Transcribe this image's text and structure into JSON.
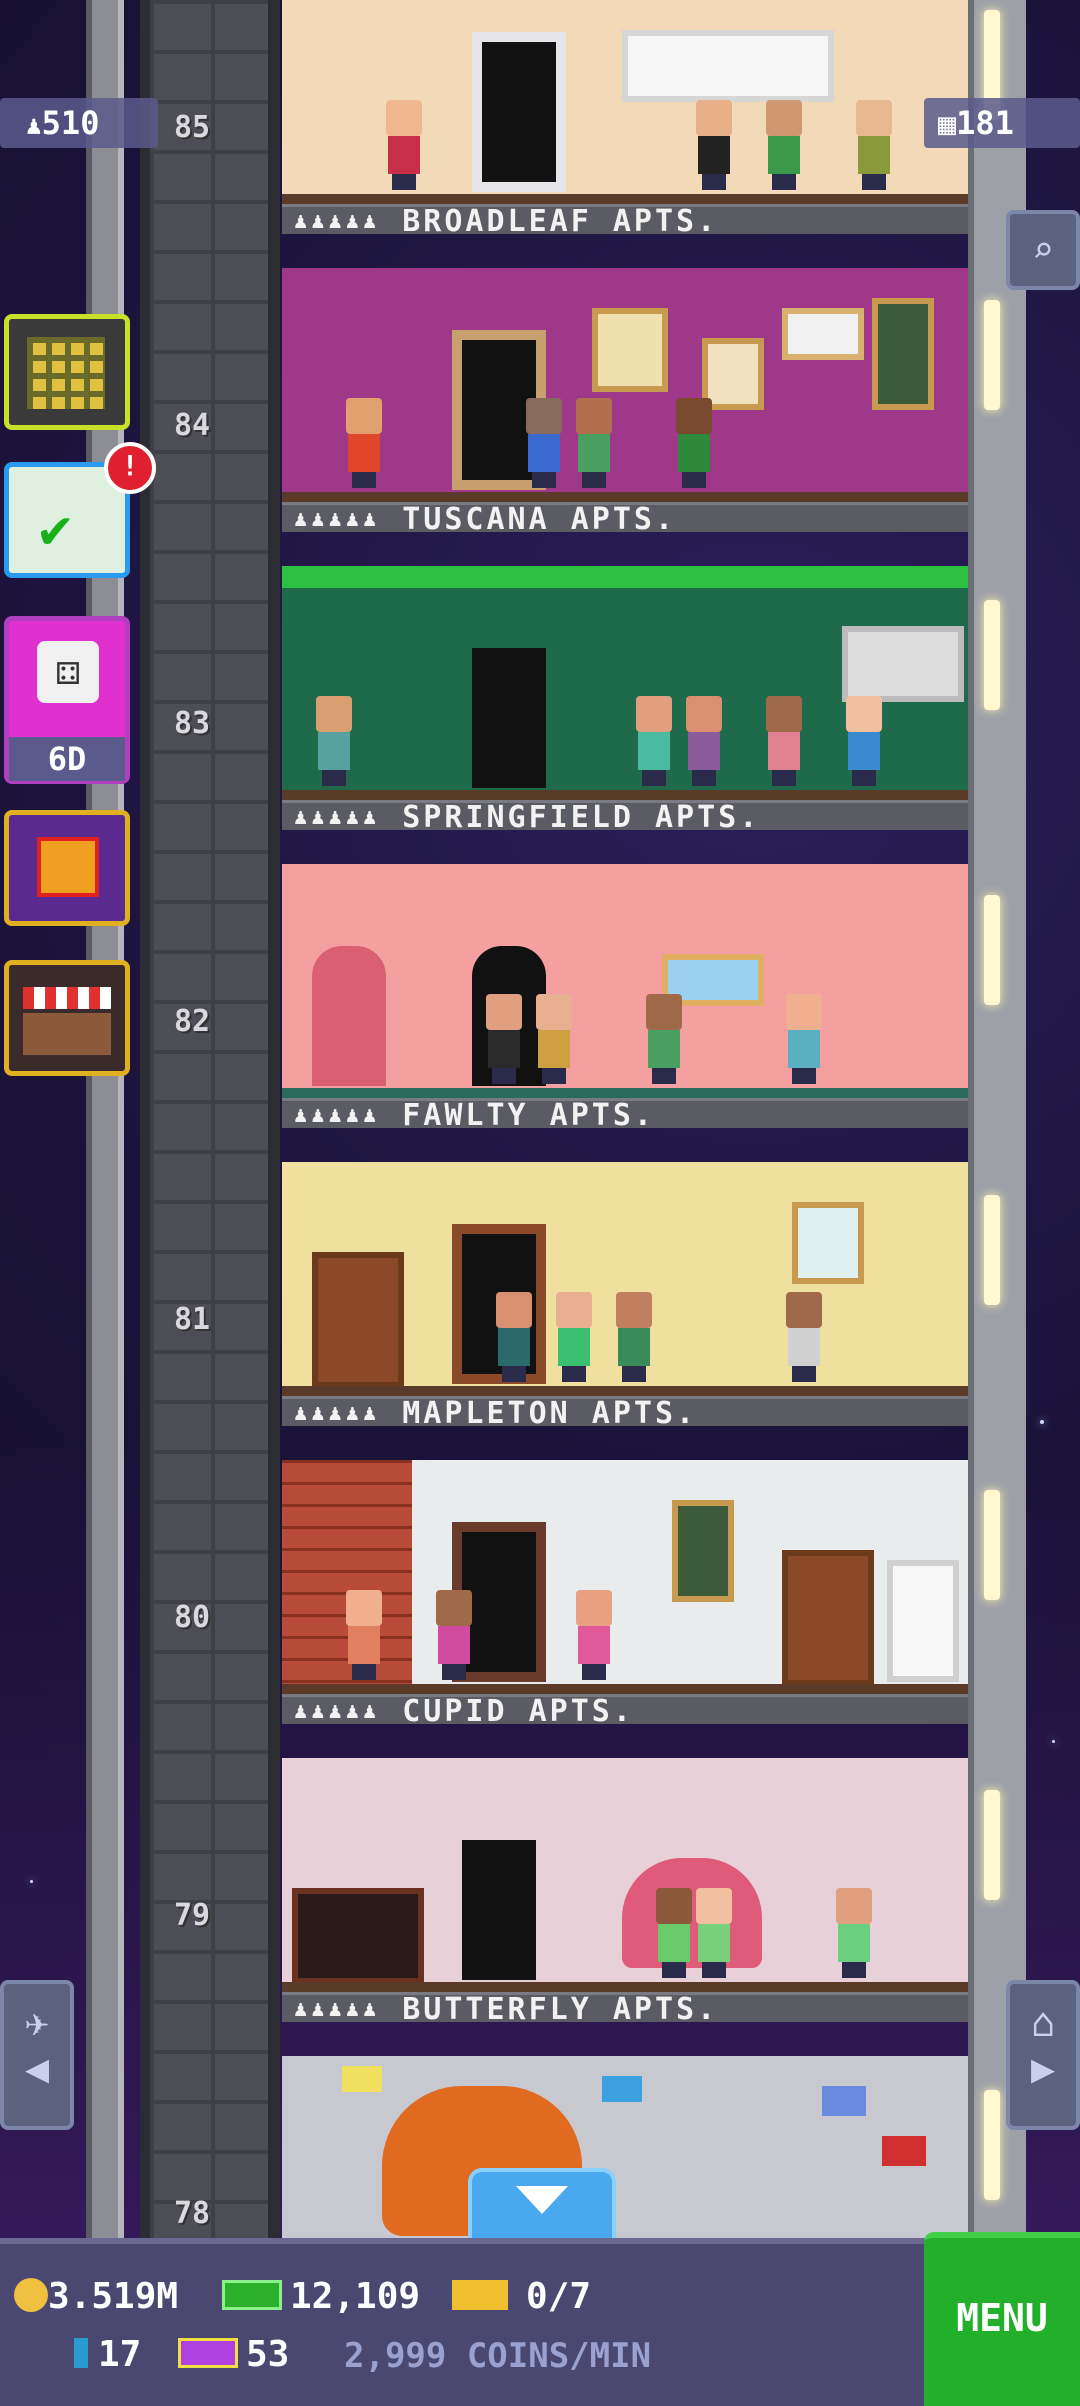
{
  "hud": {
    "population": "510",
    "floors_count": "181",
    "dice_count": "6D"
  },
  "floors": [
    {
      "number": "85",
      "name": "BROADLEAF APTS."
    },
    {
      "number": "84",
      "name": "TUSCANA APTS."
    },
    {
      "number": "83",
      "name": "SPRINGFIELD APTS."
    },
    {
      "number": "82",
      "name": "FAWLTY APTS."
    },
    {
      "number": "81",
      "name": "MAPLETON APTS."
    },
    {
      "number": "80",
      "name": "CUPID APTS."
    },
    {
      "number": "79",
      "name": "BUTTERFLY APTS."
    },
    {
      "number": "78",
      "name": ""
    }
  ],
  "bottom_bar": {
    "coins": "3.519M",
    "bux": "12,109",
    "tickets": "0/7",
    "keys": "17",
    "vip": "53",
    "rate": "2,999 COINS/MIN",
    "menu": "MENU"
  },
  "alert_badge": "!",
  "colors": {
    "menu_green": "#22b02a",
    "hud_panel": "#5a5a8c",
    "bottom_bar": "#4a4870"
  }
}
